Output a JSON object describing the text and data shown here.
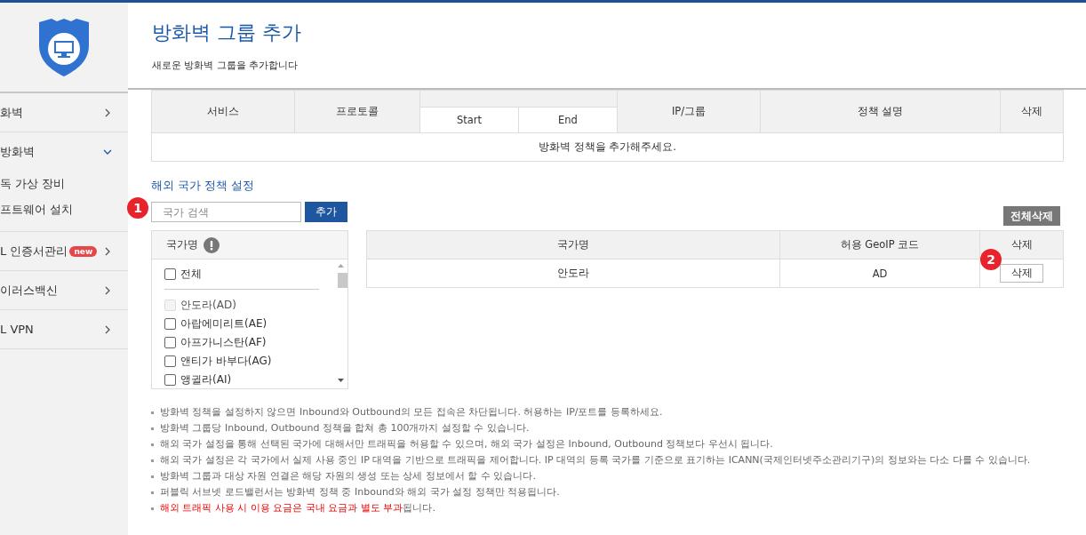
{
  "sidebar": {
    "items": [
      {
        "label": "화벽",
        "expanded": false
      },
      {
        "label": "방화벽",
        "expanded": true,
        "children": [
          {
            "label": "독 가상 장비"
          },
          {
            "label": "프트웨어 설치"
          }
        ]
      },
      {
        "label": "L 인증서관리",
        "badge": "new",
        "expanded": false
      },
      {
        "label": "이러스백신",
        "expanded": false
      },
      {
        "label": "L VPN",
        "expanded": false
      }
    ]
  },
  "header": {
    "title": "방화벽 그룹 추가",
    "subtitle": "새로운 방화벽 그룹을 추가합니다"
  },
  "policy_table": {
    "columns": [
      "서비스",
      "프로토콜",
      "Start",
      "End",
      "IP/그룹",
      "정책 설명",
      "삭제"
    ],
    "empty_message": "방화벽 정책을 추가해주세요."
  },
  "country_section": {
    "title": "해외 국가 정책 설정",
    "step_badges": [
      "1",
      "2"
    ],
    "search": {
      "placeholder": "국가 검색"
    },
    "add_button": "추가",
    "delete_all_button": "전체삭제",
    "country_list": {
      "header": "국가명",
      "all": {
        "label": "전체",
        "checked": false
      },
      "items": [
        {
          "label": "안도라(AD)",
          "checked": false,
          "disabled": true
        },
        {
          "label": "아랍에미리트(AE)",
          "checked": false,
          "disabled": false
        },
        {
          "label": "아프가니스탄(AF)",
          "checked": false,
          "disabled": false
        },
        {
          "label": "앤티가 바부다(AG)",
          "checked": false,
          "disabled": false
        },
        {
          "label": "앵귈라(AI)",
          "checked": false,
          "disabled": false
        }
      ]
    },
    "selected_table": {
      "columns": [
        "국가명",
        "허용 GeoIP 코드",
        "삭제"
      ],
      "rows": [
        {
          "name": "안도라",
          "code": "AD",
          "action": "삭제"
        }
      ]
    }
  },
  "notes": [
    {
      "text": "방화벽 정책을 설정하지 않으면 Inbound와 Outbound의 모든 접속은 차단됩니다. 허용하는 IP/포트를 등록하세요."
    },
    {
      "text": "방화벽 그룹당 Inbound, Outbound 정책을 합쳐 총 100개까지 설정할 수 있습니다."
    },
    {
      "text": "해외 국가 설정을 통해 선택된 국가에 대해서만 트래픽을 허용할 수 있으며, 해외 국가 설정은 Inbound, Outbound 정책보다 우선시 됩니다."
    },
    {
      "text": "해외 국가 설정은 각 국가에서 실제 사용 중인 IP 대역을 기반으로 트래픽을 제어합니다. IP 대역의 등록 국가를 기준으로 표기하는 ICANN(국제인터넷주소관리기구)의 정보와는 다소 다를 수 있습니다."
    },
    {
      "text": "방화벽 그룹과 대상 자원 연결은 해당 자원의 생성 또는 상세 정보에서 할 수 있습니다."
    },
    {
      "text": "퍼블릭 서브넷 로드밸런서는 방화벽 정책 중 Inbound와 해외 국가 설정 정책만 적용됩니다."
    },
    {
      "highlight": "해외 트래픽 사용 시 이용 요금은 국내 요금과 별도 부과",
      "text": "됩니다."
    }
  ]
}
